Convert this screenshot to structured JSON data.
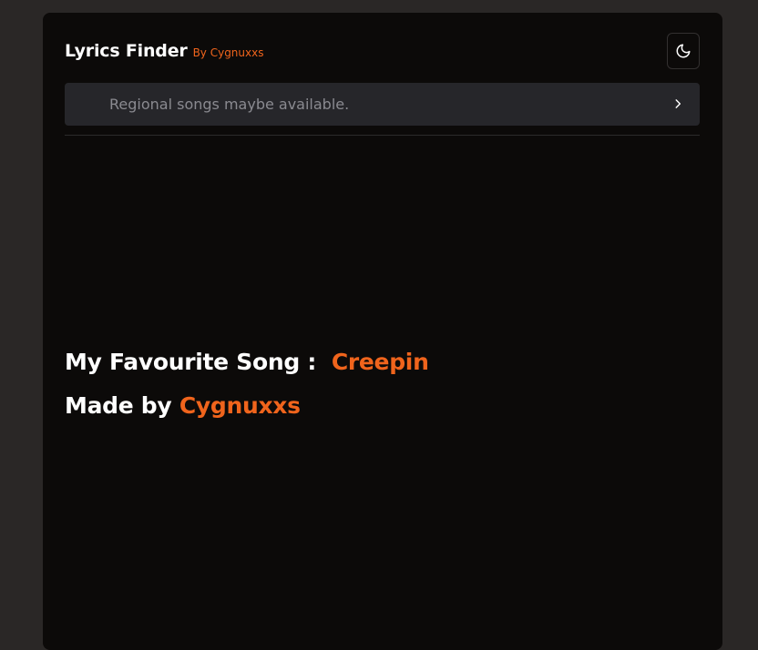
{
  "header": {
    "title": "Lyrics Finder",
    "byline": "By Cygnuxxs",
    "theme_toggle_icon": "moon-icon"
  },
  "search": {
    "placeholder": "Regional songs maybe available.",
    "chevron_icon": "chevron-right-icon"
  },
  "content": {
    "favourite_label": "My Favourite Song :",
    "favourite_song": "Creepin",
    "made_by_label": "Made by",
    "made_by_name": "Cygnuxxs"
  },
  "colors": {
    "accent": "#f0641c",
    "background": "#2a2726",
    "card": "#0c0a09"
  }
}
